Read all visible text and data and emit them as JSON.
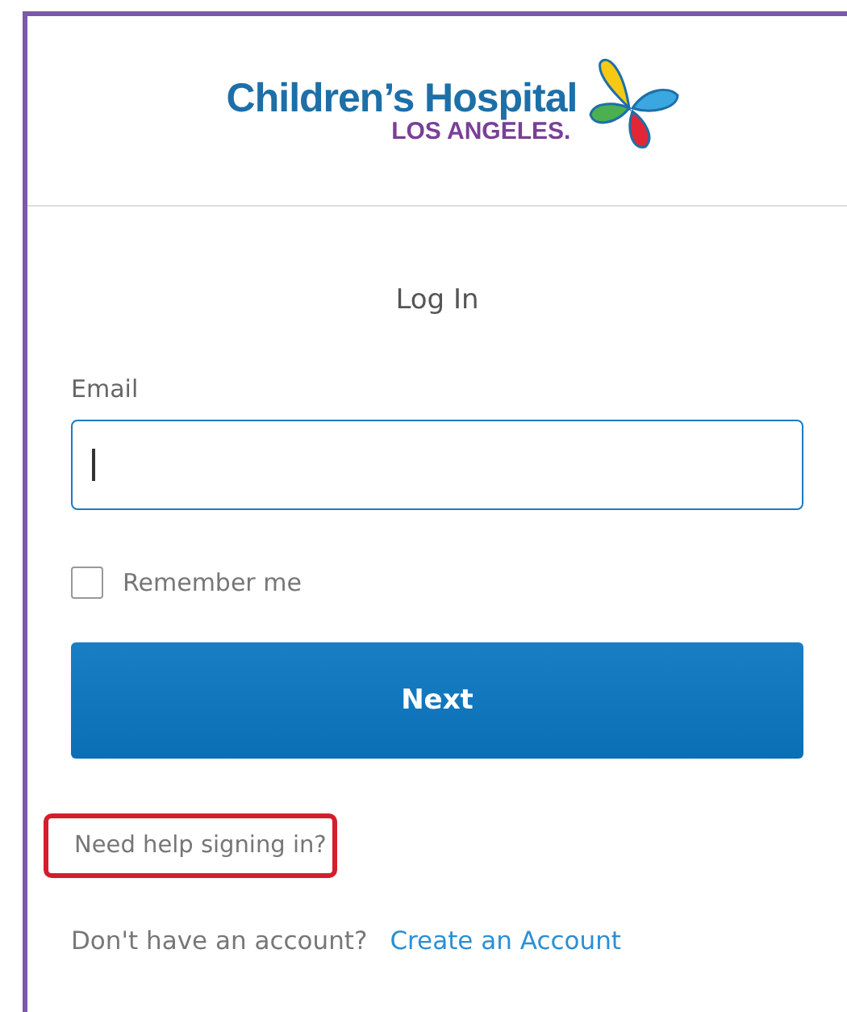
{
  "logo": {
    "name": "Children’s Hospital",
    "subtitle": "LOS ANGELES."
  },
  "form": {
    "title": "Log In",
    "email": {
      "label": "Email",
      "focused": true
    },
    "remember": {
      "label": "Remember me",
      "checked": false
    },
    "submit": "Next",
    "help_link": {
      "label": "Need help signing in?",
      "highlighted": true
    },
    "signup": {
      "prompt": "Don't have an account?",
      "link": "Create an Account"
    }
  }
}
